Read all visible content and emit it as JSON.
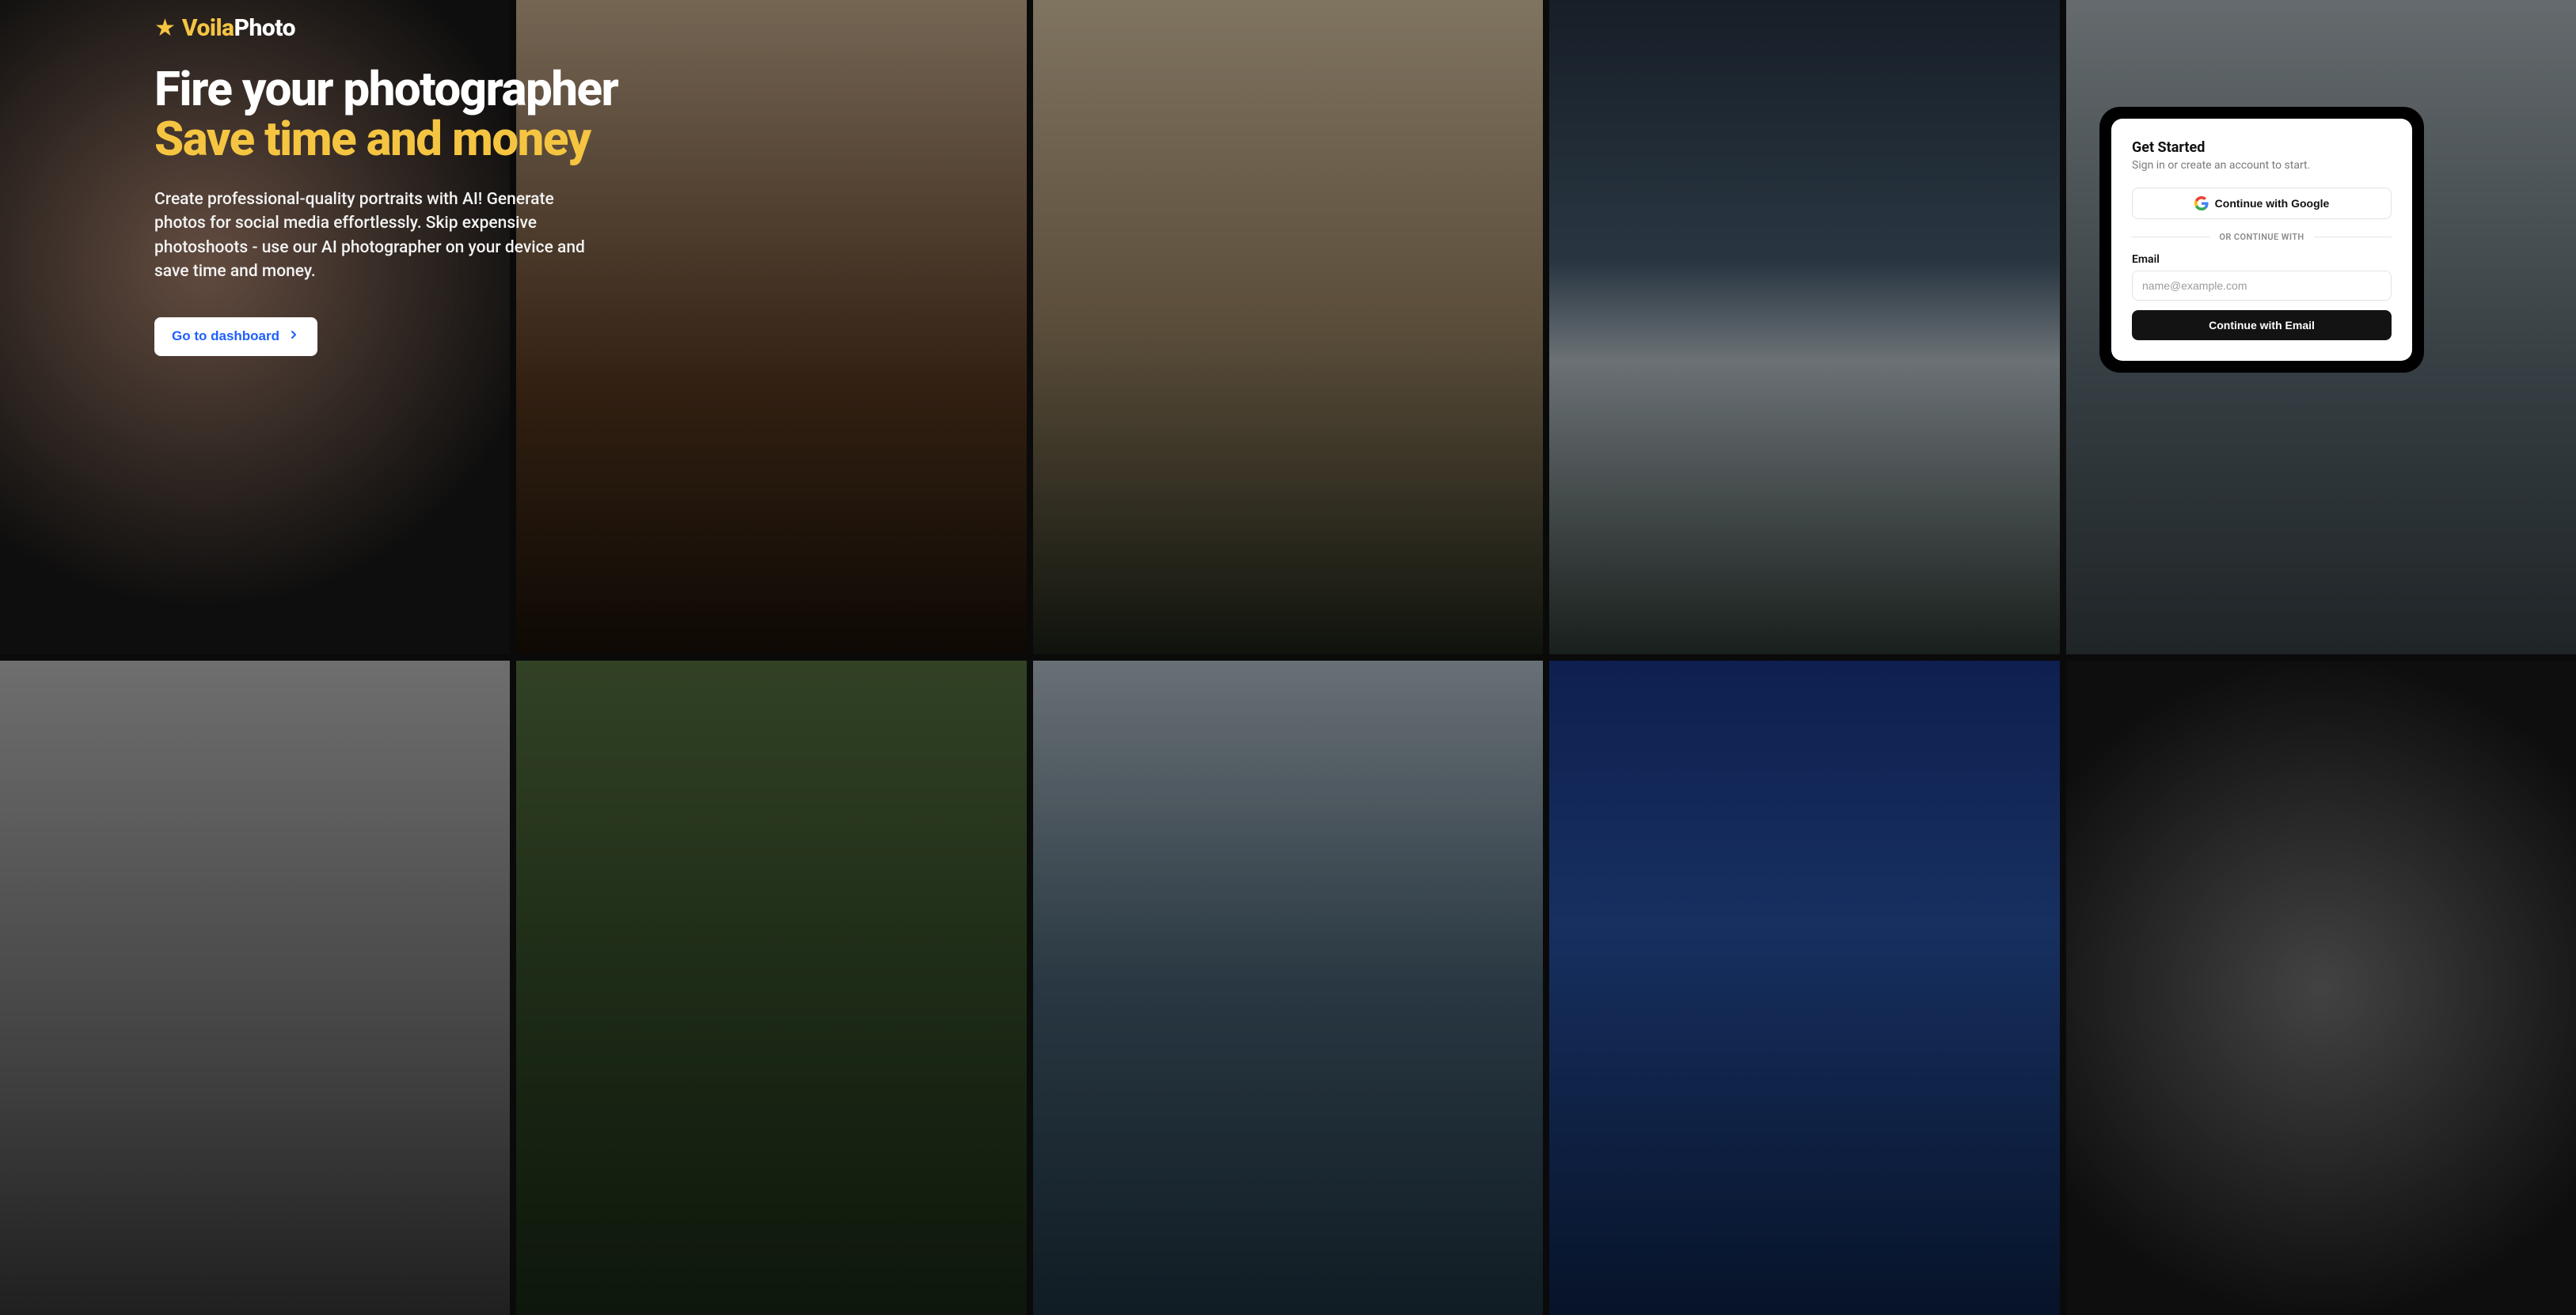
{
  "brand": {
    "voila": "Voila",
    "photo": "Photo"
  },
  "hero": {
    "headline_line1": "Fire your photographer",
    "headline_line2": "Save time and money",
    "subtext": "Create professional-quality portraits with AI! Generate photos for social media effortlessly. Skip expensive photoshoots - use our AI photographer on your device and save time and money.",
    "dashboard_button": "Go to dashboard"
  },
  "signin": {
    "title": "Get Started",
    "subtitle": "Sign in or create an account to start.",
    "google_button": "Continue with Google",
    "divider": "OR CONTINUE WITH",
    "email_label": "Email",
    "email_placeholder": "name@example.com",
    "email_button": "Continue with Email"
  },
  "colors": {
    "accent_yellow": "#f5c542",
    "link_blue": "#1f5fff",
    "card_dark": "#131313"
  }
}
